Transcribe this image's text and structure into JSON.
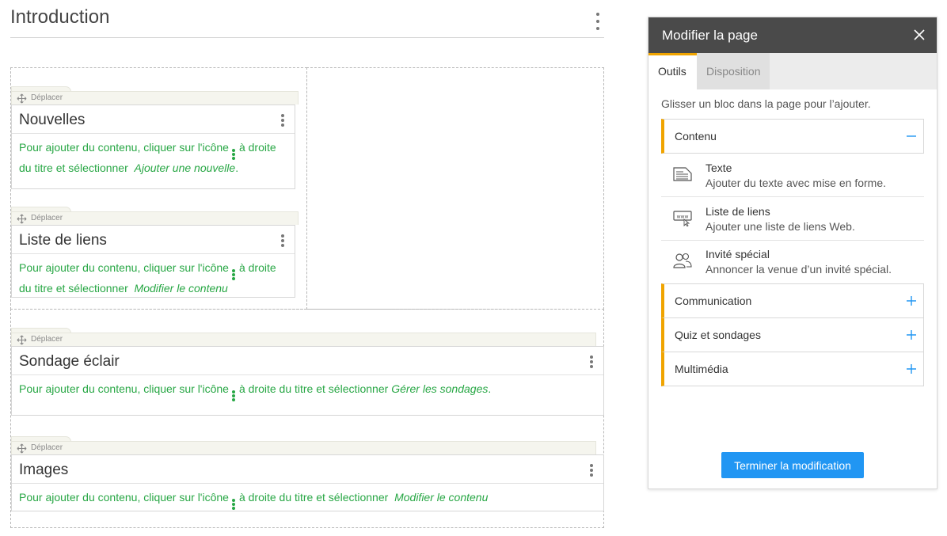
{
  "page": {
    "title": "Introduction"
  },
  "blocks": [
    {
      "handle": "Déplacer",
      "title": "Nouvelles",
      "text_before": "Pour ajouter du contenu, cliquer sur l'icône",
      "text_after": "à droite du titre et sélectionner",
      "action": "Ajouter une nouvelle",
      "end": "."
    },
    {
      "handle": "Déplacer",
      "title": "Liste de liens",
      "text_before": "Pour ajouter du contenu, cliquer sur l'icône",
      "text_after": "à droite du titre et sélectionner",
      "action": "Modifier le contenu",
      "end": ""
    },
    {
      "handle": "Déplacer",
      "title": "Sondage éclair",
      "text_before": "Pour ajouter du contenu, cliquer sur l'icône",
      "text_after": "à droite du titre et sélectionner",
      "action": "Gérer les sondages",
      "end": "."
    },
    {
      "handle": "Déplacer",
      "title": "Images",
      "text_before": "Pour ajouter du contenu, cliquer sur l'icône",
      "text_after": "à droite du titre et sélectionner",
      "action": "Modifier le contenu",
      "end": ""
    }
  ],
  "panel": {
    "title": "Modifier la page",
    "tabs": [
      {
        "label": "Outils",
        "active": true
      },
      {
        "label": "Disposition",
        "active": false
      }
    ],
    "hint": "Glisser un bloc dans la page pour l’ajouter.",
    "sections": [
      {
        "label": "Contenu",
        "expanded": true
      },
      {
        "label": "Communication",
        "expanded": false
      },
      {
        "label": "Quiz et sondages",
        "expanded": false
      },
      {
        "label": "Multimédia",
        "expanded": false
      }
    ],
    "tools": [
      {
        "name": "Texte",
        "description": "Ajouter du texte avec mise en forme.",
        "icon": "text-document-icon"
      },
      {
        "name": "Liste de liens",
        "description": "Ajouter une liste de liens Web.",
        "icon": "www-link-icon"
      },
      {
        "name": "Invité spécial",
        "description": "Annoncer la venue d’un invité spécial.",
        "icon": "guest-users-icon"
      }
    ],
    "finish_label": "Terminer la modification"
  },
  "colors": {
    "accent": "#f0a400",
    "primary_button": "#2196f3",
    "panel_header": "#4a4a4a",
    "hint_text": "#28a745"
  }
}
